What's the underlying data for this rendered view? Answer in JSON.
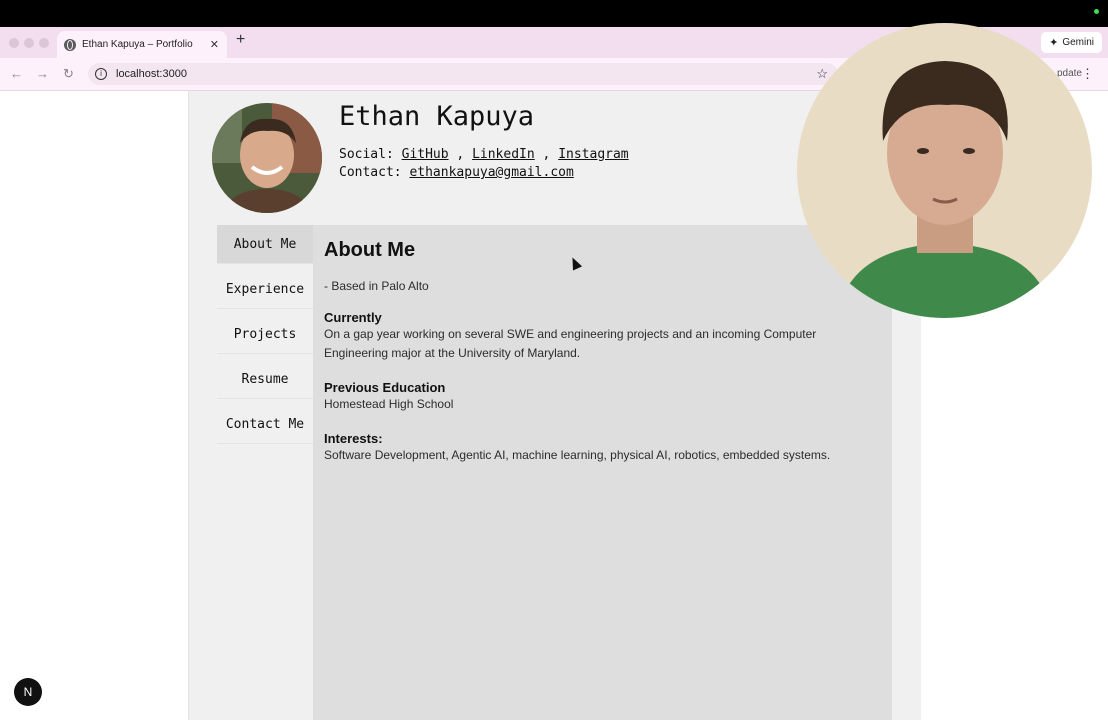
{
  "browser": {
    "tab_title": "Ethan Kapuya – Portfolio",
    "url": "localhost:3000",
    "gemini_label": "Gemini",
    "update_label": "pdate"
  },
  "profile": {
    "name": "Ethan Kapuya",
    "social_label": "Social:",
    "social_links": [
      "GitHub",
      "LinkedIn",
      "Instagram"
    ],
    "contact_label": "Contact:",
    "email": "ethankapuya@gmail.com"
  },
  "nav": {
    "items": [
      "About Me",
      "Experience",
      "Projects",
      "Resume",
      "Contact Me"
    ],
    "active": "About Me"
  },
  "about": {
    "title": "About Me",
    "location": "- Based in Palo Alto",
    "sections": [
      {
        "heading": "Currently",
        "text": "On a gap year working on several SWE and engineering projects and an incoming Computer Engineering major at the University of Maryland."
      },
      {
        "heading": "Previous Education",
        "text": "Homestead High School"
      },
      {
        "heading": "Interests:",
        "text": "Software Development, Agentic AI, machine learning, physical AI, robotics, embedded systems."
      }
    ]
  },
  "dev_badge": "N"
}
